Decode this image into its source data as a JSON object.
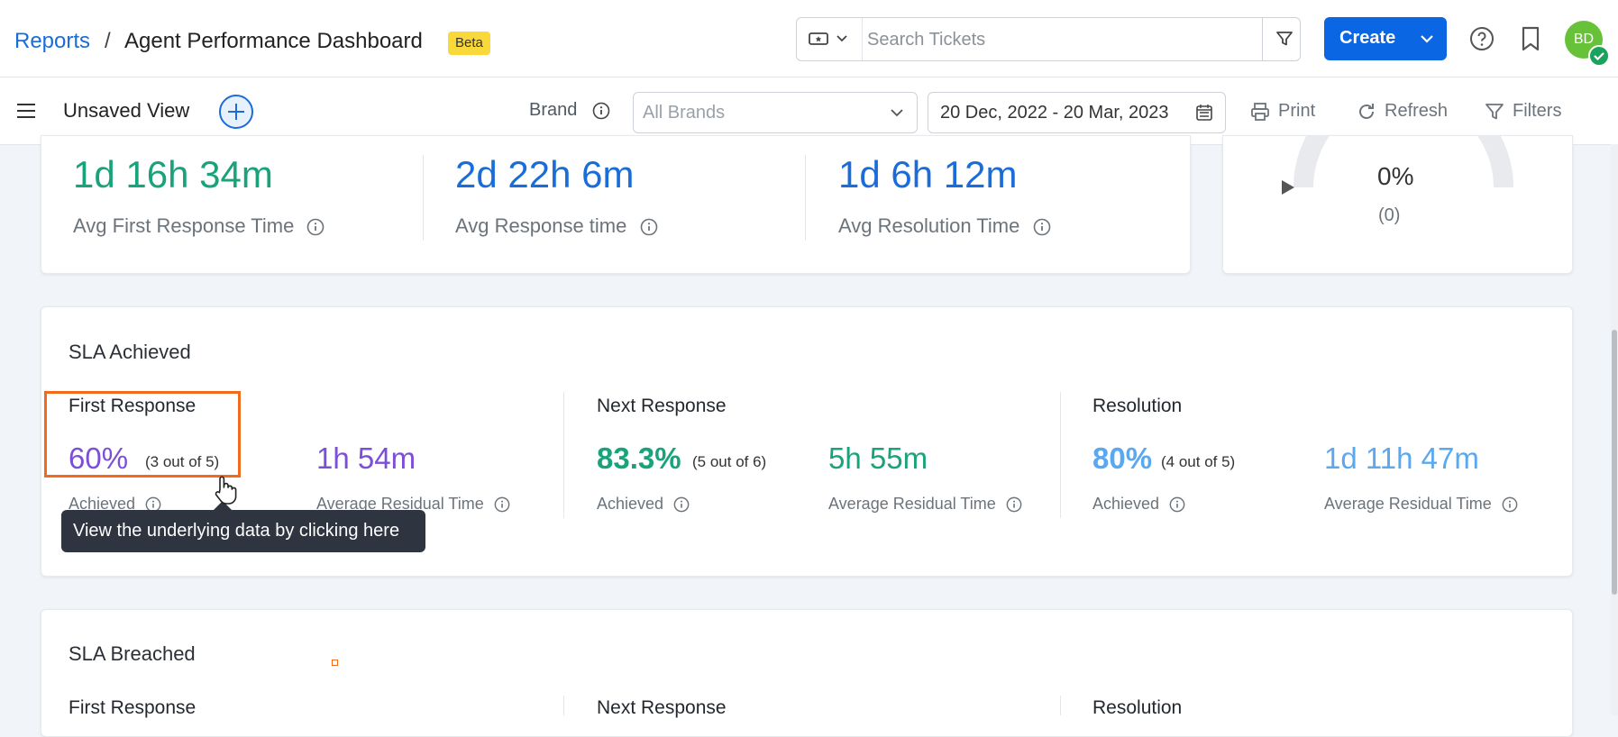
{
  "header": {
    "breadcrumb_link": "Reports",
    "breadcrumb_sep": "/",
    "page_title": "Agent Performance Dashboard",
    "badge": "Beta",
    "search_placeholder": "Search Tickets",
    "create_label": "Create",
    "avatar_initials": "BD"
  },
  "toolbar": {
    "view_name": "Unsaved View",
    "brand_label": "Brand",
    "brand_value": "All Brands",
    "date_range": "20 Dec, 2022 - 20 Mar, 2023",
    "print_label": "Print",
    "refresh_label": "Refresh",
    "filters_label": "Filters"
  },
  "time_metrics": [
    {
      "value": "1d 16h 34m",
      "label": "Avg First Response Time",
      "color": "#1aa37a"
    },
    {
      "value": "2d 22h 6m",
      "label": "Avg Response time",
      "color": "#1a6dd8"
    },
    {
      "value": "1d 6h 12m",
      "label": "Avg Resolution Time",
      "color": "#1a6dd8"
    }
  ],
  "gauge": {
    "value": "0%",
    "count": "(0)"
  },
  "sla_achieved": {
    "title": "SLA Achieved",
    "groups": [
      {
        "title": "First Response",
        "pct": "60%",
        "out_of": "(3 out of 5)",
        "achieved_label": "Achieved",
        "residual": "1h 54m",
        "residual_label": "Average Residual Time",
        "color": "#7b4fd6"
      },
      {
        "title": "Next Response",
        "pct": "83.3%",
        "out_of": "(5 out of 6)",
        "achieved_label": "Achieved",
        "residual": "5h 55m",
        "residual_label": "Average Residual Time",
        "color": "#1aa37a"
      },
      {
        "title": "Resolution",
        "pct": "80%",
        "out_of": "(4 out of 5)",
        "achieved_label": "Achieved",
        "residual": "1d 11h 47m",
        "residual_label": "Average Residual Time",
        "color": "#5aa8ef"
      }
    ]
  },
  "tooltip": "View the underlying data by clicking here",
  "sla_breached": {
    "title": "SLA Breached",
    "groups": [
      {
        "title": "First Response"
      },
      {
        "title": "Next Response"
      },
      {
        "title": "Resolution"
      }
    ]
  }
}
